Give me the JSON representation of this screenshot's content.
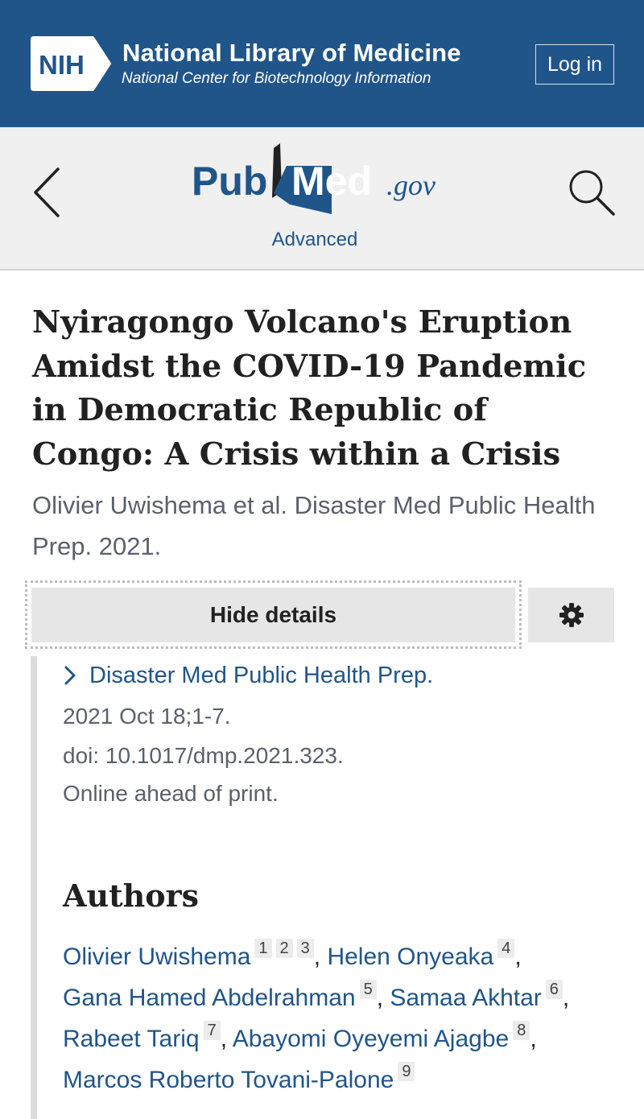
{
  "header": {
    "logo_text": "NIH",
    "title": "National Library of Medicine",
    "subtitle": "National Center for Biotechnology Information",
    "login_label": "Log in",
    "bg_color": "#20558a"
  },
  "pubmed_bar": {
    "logo_text_pub": "Pub",
    "logo_text_med": "Med",
    "logo_text_gov": ".gov",
    "advanced_label": "Advanced",
    "back_icon": "chevron-left-icon",
    "search_icon": "search-icon"
  },
  "article": {
    "title": "Nyiragongo Volcano's Eruption Amidst the COVID-19 Pandemic in Democratic Republic of Congo: A Crisis within a Crisis",
    "citation": "Olivier Uwishema et al. Disaster Med Public Health Prep. 2021."
  },
  "details": {
    "toggle_label": "Hide details",
    "settings_icon": "gear-icon",
    "journal": "Disaster Med Public Health Prep.",
    "date_pages": "2021 Oct 18;1-7.",
    "doi": "doi: 10.1017/dmp.2021.323.",
    "status": "Online ahead of print."
  },
  "authors": {
    "heading": "Authors",
    "list": [
      {
        "name": "Olivier Uwishema",
        "affiliations": [
          "1",
          "2",
          "3"
        ]
      },
      {
        "name": "Helen Onyeaka",
        "affiliations": [
          "4"
        ]
      },
      {
        "name": "Gana Hamed Abdelrahman",
        "affiliations": [
          "5"
        ]
      },
      {
        "name": "Samaa Akhtar",
        "affiliations": [
          "6"
        ]
      },
      {
        "name": "Rabeet Tariq",
        "affiliations": [
          "7"
        ]
      },
      {
        "name": "Abayomi Oyeyemi Ajagbe",
        "affiliations": [
          "8"
        ]
      },
      {
        "name": "Marcos Roberto Tovani-Palone",
        "affiliations": [
          "9"
        ]
      }
    ]
  }
}
